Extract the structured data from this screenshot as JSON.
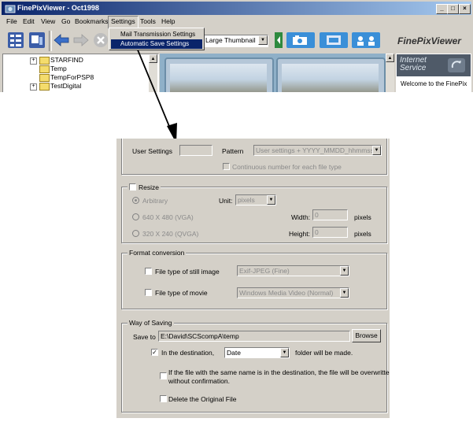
{
  "window": {
    "title": "FinePixViewer - Oct1998",
    "minimize_glyph": "_",
    "restore_glyph": "□",
    "close_glyph": "×"
  },
  "menu": {
    "items": [
      "File",
      "Edit",
      "View",
      "Go",
      "Bookmarks",
      "Settings",
      "Tools",
      "Help"
    ],
    "settings_dropdown": [
      "Mail Transmission Settings",
      "Automatic Save Settings"
    ]
  },
  "toolbar": {
    "view_mode": "Large Thumbnail",
    "brand": "FinePixViewer"
  },
  "tree": {
    "items": [
      {
        "label": "STARFIND",
        "expandable": true
      },
      {
        "label": "Temp",
        "expandable": false
      },
      {
        "label": "TempForPSP8",
        "expandable": false
      },
      {
        "label": "TestDigital",
        "expandable": true
      }
    ]
  },
  "internet": {
    "line1": "Internet",
    "line2": "Service",
    "welcome": "Welcome to the FinePix"
  },
  "settings": {
    "user_settings_label": "User Settings",
    "pattern_label": "Pattern",
    "pattern_value": "User settings + YYYY_MMDD_hhmmss",
    "continuous_label": "Continuous number for each file type",
    "resize": {
      "legend": "Resize",
      "arbitrary": "Arbitrary",
      "unit_label": "Unit:",
      "unit_value": "pixels",
      "vga": "640 X 480 (VGA)",
      "qvga": "320 X 240 (QVGA)",
      "width_label": "Width:",
      "width_value": "0",
      "height_label": "Height:",
      "height_value": "0",
      "pixels_label": "pixels"
    },
    "format": {
      "legend": "Format conversion",
      "still_label": "File type of still image",
      "still_value": "Exif-JPEG (Fine)",
      "movie_label": "File type of movie",
      "movie_value": "Windows Media Video (Normal)"
    },
    "saving": {
      "legend": "Way of Saving",
      "save_to_label": "Save to",
      "save_to_value": "E:\\David\\SCScompA\\temp",
      "browse": "Browse",
      "destination_label": "In the destination,",
      "destination_value": "Date",
      "folder_suffix": "folder will be made.",
      "overwrite_line1": "If the file with the same name is in the destination, the file will be overwritten",
      "overwrite_line2": "without confirmation.",
      "delete_label": "Delete the Original File"
    }
  }
}
